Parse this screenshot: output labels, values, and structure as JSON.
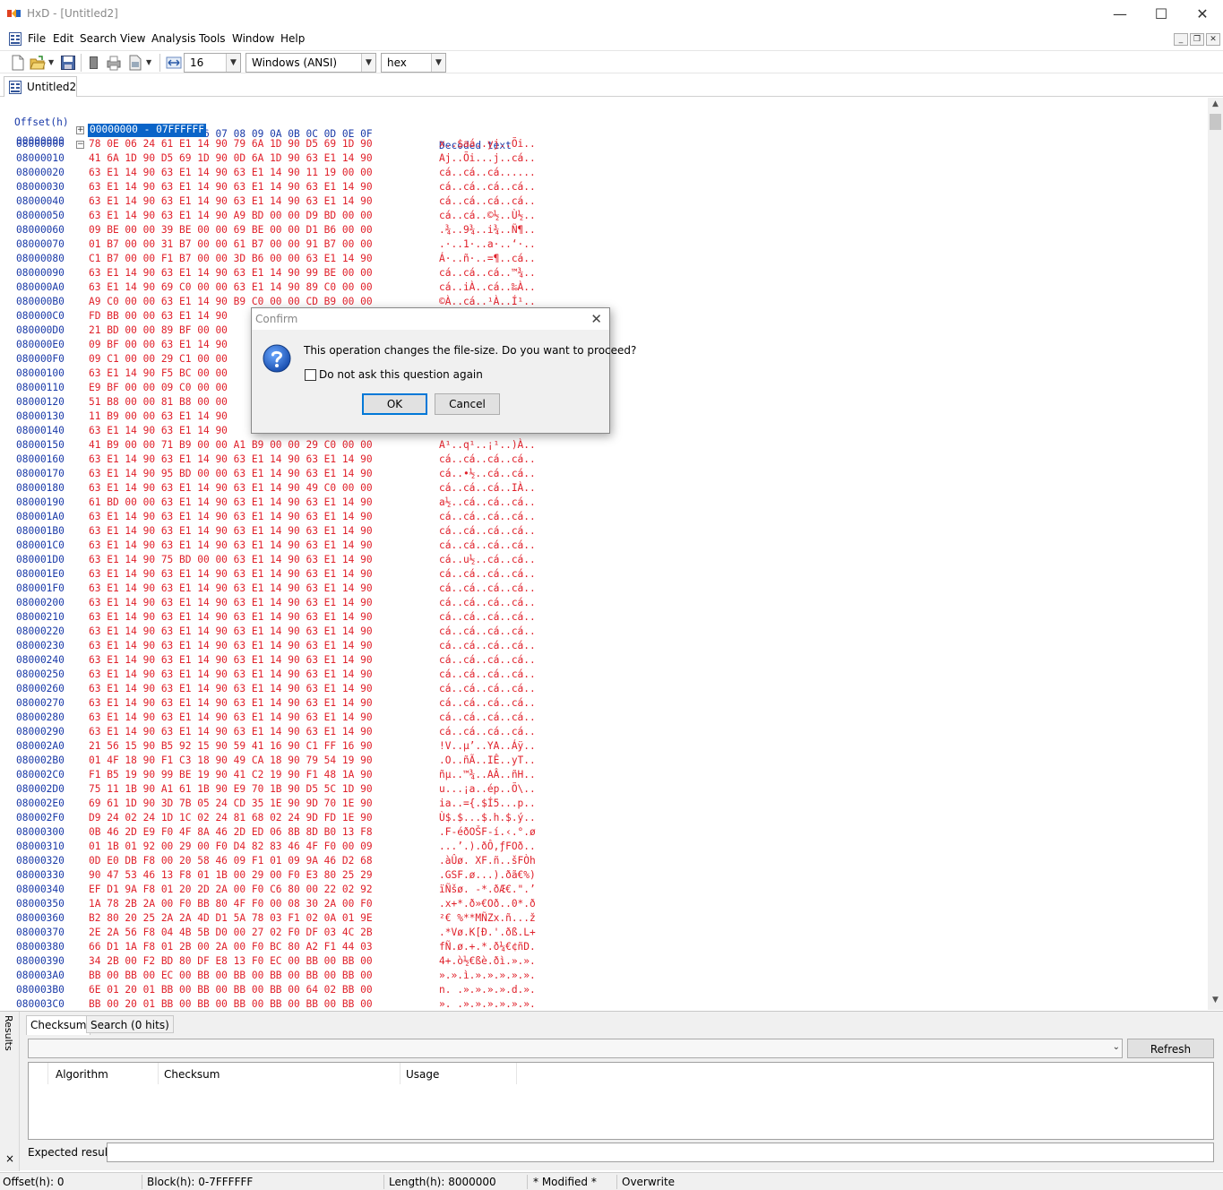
{
  "window": {
    "title": "HxD - [Untitled2]",
    "minimize": "—",
    "maximize": "☐",
    "close": "✕"
  },
  "menu": {
    "items": [
      "File",
      "Edit",
      "Search",
      "View",
      "Analysis",
      "Tools",
      "Window",
      "Help"
    ],
    "mdi_buttons": [
      "_",
      "❐",
      "✕"
    ]
  },
  "toolbar": {
    "bytes_per_row": "16",
    "charset": "Windows (ANSI)",
    "offset_base": "hex"
  },
  "tabs": {
    "document": "Untitled2"
  },
  "hex": {
    "header_offset": "Offset(h)",
    "header_columns": "00 01 02 03 04 05 06 07 08 09 0A 0B 0C 0D 0E 0F",
    "header_decoded": "Decoded text",
    "range_row": {
      "offset": "00000000",
      "tree": "+",
      "selection": "00000000 - 07FFFFFF"
    },
    "rows": [
      {
        "off": "08000000",
        "tree": "−",
        "b": "78 0E 06 24 61 E1 14 90 79 6A 1D 90 D5 69 1D 90",
        "t": "x..$aá..yj..Õi.."
      },
      {
        "off": "08000010",
        "b": "41 6A 1D 90 D5 69 1D 90 0D 6A 1D 90 63 E1 14 90",
        "t": "Aj..Õi...j..cá.."
      },
      {
        "off": "08000020",
        "b": "63 E1 14 90 63 E1 14 90 63 E1 14 90 11 19 00 00",
        "t": "cá..cá..cá......"
      },
      {
        "off": "08000030",
        "b": "63 E1 14 90 63 E1 14 90 63 E1 14 90 63 E1 14 90",
        "t": "cá..cá..cá..cá.."
      },
      {
        "off": "08000040",
        "b": "63 E1 14 90 63 E1 14 90 63 E1 14 90 63 E1 14 90",
        "t": "cá..cá..cá..cá.."
      },
      {
        "off": "08000050",
        "b": "63 E1 14 90 63 E1 14 90 A9 BD 00 00 D9 BD 00 00",
        "t": "cá..cá..©½..Ù½.."
      },
      {
        "off": "08000060",
        "b": "09 BE 00 00 39 BE 00 00 69 BE 00 00 D1 B6 00 00",
        "t": ".¾..9¾..i¾..Ñ¶.."
      },
      {
        "off": "08000070",
        "b": "01 B7 00 00 31 B7 00 00 61 B7 00 00 91 B7 00 00",
        "t": ".·..1·..a·..‘·.."
      },
      {
        "off": "08000080",
        "b": "C1 B7 00 00 F1 B7 00 00 3D B6 00 00 63 E1 14 90",
        "t": "Á·..ñ·..=¶..cá.."
      },
      {
        "off": "08000090",
        "b": "63 E1 14 90 63 E1 14 90 63 E1 14 90 99 BE 00 00",
        "t": "cá..cá..cá..™¾.."
      },
      {
        "off": "080000A0",
        "b": "63 E1 14 90 69 C0 00 00 63 E1 14 90 89 C0 00 00",
        "t": "cá..iÀ..cá..‰À.."
      },
      {
        "off": "080000B0",
        "b": "A9 C0 00 00 63 E1 14 90 B9 C0 00 00 CD B9 00 00",
        "t": "©À..cá..¹À..Í¹.."
      },
      {
        "off": "080000C0",
        "b": "FD BB 00 00 63 E1 14 90",
        "t": ""
      },
      {
        "off": "080000D0",
        "b": "21 BD 00 00 89 BF 00 00",
        "t": ""
      },
      {
        "off": "080000E0",
        "b": "09 BF 00 00 63 E1 14 90",
        "t": ""
      },
      {
        "off": "080000F0",
        "b": "09 C1 00 00 29 C1 00 00",
        "t": ""
      },
      {
        "off": "08000100",
        "b": "63 E1 14 90 F5 BC 00 00",
        "t": ""
      },
      {
        "off": "08000110",
        "b": "E9 BF 00 00 09 C0 00 00",
        "t": ""
      },
      {
        "off": "08000120",
        "b": "51 B8 00 00 81 B8 00 00",
        "t": ""
      },
      {
        "off": "08000130",
        "b": "11 B9 00 00 63 E1 14 90",
        "t": ""
      },
      {
        "off": "08000140",
        "b": "63 E1 14 90 63 E1 14 90",
        "t": ""
      },
      {
        "off": "08000150",
        "b": "41 B9 00 00 71 B9 00 00 A1 B9 00 00 29 C0 00 00",
        "t": "A¹..q¹..¡¹..)À.."
      },
      {
        "off": "08000160",
        "b": "63 E1 14 90 63 E1 14 90 63 E1 14 90 63 E1 14 90",
        "t": "cá..cá..cá..cá.."
      },
      {
        "off": "08000170",
        "b": "63 E1 14 90 95 BD 00 00 63 E1 14 90 63 E1 14 90",
        "t": "cá..•½..cá..cá.."
      },
      {
        "off": "08000180",
        "b": "63 E1 14 90 63 E1 14 90 63 E1 14 90 49 C0 00 00",
        "t": "cá..cá..cá..IÀ.."
      },
      {
        "off": "08000190",
        "b": "61 BD 00 00 63 E1 14 90 63 E1 14 90 63 E1 14 90",
        "t": "a½..cá..cá..cá.."
      },
      {
        "off": "080001A0",
        "b": "63 E1 14 90 63 E1 14 90 63 E1 14 90 63 E1 14 90",
        "t": "cá..cá..cá..cá.."
      },
      {
        "off": "080001B0",
        "b": "63 E1 14 90 63 E1 14 90 63 E1 14 90 63 E1 14 90",
        "t": "cá..cá..cá..cá.."
      },
      {
        "off": "080001C0",
        "b": "63 E1 14 90 63 E1 14 90 63 E1 14 90 63 E1 14 90",
        "t": "cá..cá..cá..cá.."
      },
      {
        "off": "080001D0",
        "b": "63 E1 14 90 75 BD 00 00 63 E1 14 90 63 E1 14 90",
        "t": "cá..u½..cá..cá.."
      },
      {
        "off": "080001E0",
        "b": "63 E1 14 90 63 E1 14 90 63 E1 14 90 63 E1 14 90",
        "t": "cá..cá..cá..cá.."
      },
      {
        "off": "080001F0",
        "b": "63 E1 14 90 63 E1 14 90 63 E1 14 90 63 E1 14 90",
        "t": "cá..cá..cá..cá.."
      },
      {
        "off": "08000200",
        "b": "63 E1 14 90 63 E1 14 90 63 E1 14 90 63 E1 14 90",
        "t": "cá..cá..cá..cá.."
      },
      {
        "off": "08000210",
        "b": "63 E1 14 90 63 E1 14 90 63 E1 14 90 63 E1 14 90",
        "t": "cá..cá..cá..cá.."
      },
      {
        "off": "08000220",
        "b": "63 E1 14 90 63 E1 14 90 63 E1 14 90 63 E1 14 90",
        "t": "cá..cá..cá..cá.."
      },
      {
        "off": "08000230",
        "b": "63 E1 14 90 63 E1 14 90 63 E1 14 90 63 E1 14 90",
        "t": "cá..cá..cá..cá.."
      },
      {
        "off": "08000240",
        "b": "63 E1 14 90 63 E1 14 90 63 E1 14 90 63 E1 14 90",
        "t": "cá..cá..cá..cá.."
      },
      {
        "off": "08000250",
        "b": "63 E1 14 90 63 E1 14 90 63 E1 14 90 63 E1 14 90",
        "t": "cá..cá..cá..cá.."
      },
      {
        "off": "08000260",
        "b": "63 E1 14 90 63 E1 14 90 63 E1 14 90 63 E1 14 90",
        "t": "cá..cá..cá..cá.."
      },
      {
        "off": "08000270",
        "b": "63 E1 14 90 63 E1 14 90 63 E1 14 90 63 E1 14 90",
        "t": "cá..cá..cá..cá.."
      },
      {
        "off": "08000280",
        "b": "63 E1 14 90 63 E1 14 90 63 E1 14 90 63 E1 14 90",
        "t": "cá..cá..cá..cá.."
      },
      {
        "off": "08000290",
        "b": "63 E1 14 90 63 E1 14 90 63 E1 14 90 63 E1 14 90",
        "t": "cá..cá..cá..cá.."
      },
      {
        "off": "080002A0",
        "b": "21 56 15 90 B5 92 15 90 59 41 16 90 C1 FF 16 90",
        "t": "!V..µ’..YA..Áÿ.."
      },
      {
        "off": "080002B0",
        "b": "01 4F 18 90 F1 C3 18 90 49 CA 18 90 79 54 19 90",
        "t": ".O..ñÃ..IÊ..yT.."
      },
      {
        "off": "080002C0",
        "b": "F1 B5 19 90 99 BE 19 90 41 C2 19 90 F1 48 1A 90",
        "t": "ñµ..™¾..AÂ..ñH.."
      },
      {
        "off": "080002D0",
        "b": "75 11 1B 90 A1 61 1B 90 E9 70 1B 90 D5 5C 1D 90",
        "t": "u...¡a..ép..Õ\\.."
      },
      {
        "off": "080002E0",
        "b": "69 61 1D 90 3D 7B 05 24 CD 35 1E 90 9D 70 1E 90",
        "t": "ia..={.$Í5...p.."
      },
      {
        "off": "080002F0",
        "b": "D9 24 02 24 1D 1C 02 24 81 68 02 24 9D FD 1E 90",
        "t": "Ù$.$...$.h.$.ý.."
      },
      {
        "off": "08000300",
        "b": "0B 46 2D E9 F0 4F 8A 46 2D ED 06 8B 8D B0 13 F8",
        "t": ".F-éðOŠF-í.‹.°.ø"
      },
      {
        "off": "08000310",
        "b": "01 1B 01 92 00 29 00 F0 D4 82 83 46 4F F0 00 09",
        "t": "...’.).ðÔ‚ƒFOð.."
      },
      {
        "off": "08000320",
        "b": "0D E0 DB F8 00 20 58 46 09 F1 01 09 9A 46 D2 68",
        "t": ".àÛø. XF.ñ..šFÒh"
      },
      {
        "off": "08000330",
        "b": "90 47 53 46 13 F8 01 1B 00 29 00 F0 E3 80 25 29",
        "t": ".GSF.ø...).ðã€%)"
      },
      {
        "off": "08000340",
        "b": "EF D1 9A F8 01 20 2D 2A 00 F0 C6 80 00 22 02 92",
        "t": "ïÑšø. -*.ðÆ€.\".’"
      },
      {
        "off": "08000350",
        "b": "1A 78 2B 2A 00 F0 BB 80 4F F0 00 08 30 2A 00 F0",
        "t": ".x+*.ð»€Oð..0*.ð"
      },
      {
        "off": "08000360",
        "b": "B2 80 20 25 2A 2A 4D D1 5A 78 03 F1 02 0A 01 9E",
        "t": "²€ %**MÑZx.ñ...ž"
      },
      {
        "off": "08000370",
        "b": "2E 2A 56 F8 04 4B 5B D0 00 27 02 F0 DF 03 4C 2B",
        "t": ".*Vø.K[Ð.'.ðß.L+"
      },
      {
        "off": "08000380",
        "b": "66 D1 1A F8 01 2B 00 2A 00 F0 BC 80 A2 F1 44 03",
        "t": "fÑ.ø.+.*.ð¼€¢ñD."
      },
      {
        "off": "08000390",
        "b": "34 2B 00 F2 BD 80 DF E8 13 F0 EC 00 BB 00 BB 00",
        "t": "4+.ò½€ßè.ðì.».»."
      },
      {
        "off": "080003A0",
        "b": "BB 00 BB 00 EC 00 BB 00 BB 00 BB 00 BB 00 BB 00",
        "t": "».».ì.».».».».»."
      },
      {
        "off": "080003B0",
        "b": "6E 01 20 01 BB 00 BB 00 BB 00 BB 00 64 02 BB 00",
        "t": "n. .».».».».d.»."
      },
      {
        "off": "080003C0",
        "b": "BB 00 20 01 BB 00 BB 00 BB 00 BB 00 BB 00 BB 00",
        "t": "». .».».».».».»."
      }
    ]
  },
  "results": {
    "side_label": "Results",
    "close": "×",
    "tabs": [
      "Checksum",
      "Search (0 hits)"
    ],
    "refresh": "Refresh",
    "columns": [
      "Algorithm",
      "Checksum",
      "Usage"
    ],
    "expected_label": "Expected result:",
    "expected_value": ""
  },
  "status": {
    "offset": "Offset(h): 0",
    "block": "Block(h): 0-7FFFFFF",
    "length": "Length(h): 8000000",
    "modified": "* Modified *",
    "mode": "Overwrite"
  },
  "dialog": {
    "title": "Confirm",
    "close": "✕",
    "message": "This operation changes the file-size. Do you want to proceed?",
    "checkbox_label": "Do not ask this question again",
    "ok": "OK",
    "cancel": "Cancel"
  },
  "colors": {
    "offset_blue": "#1a3aa8",
    "data_red": "#e0202a",
    "selection": "#0a64c8",
    "focus_border": "#0078d7"
  }
}
